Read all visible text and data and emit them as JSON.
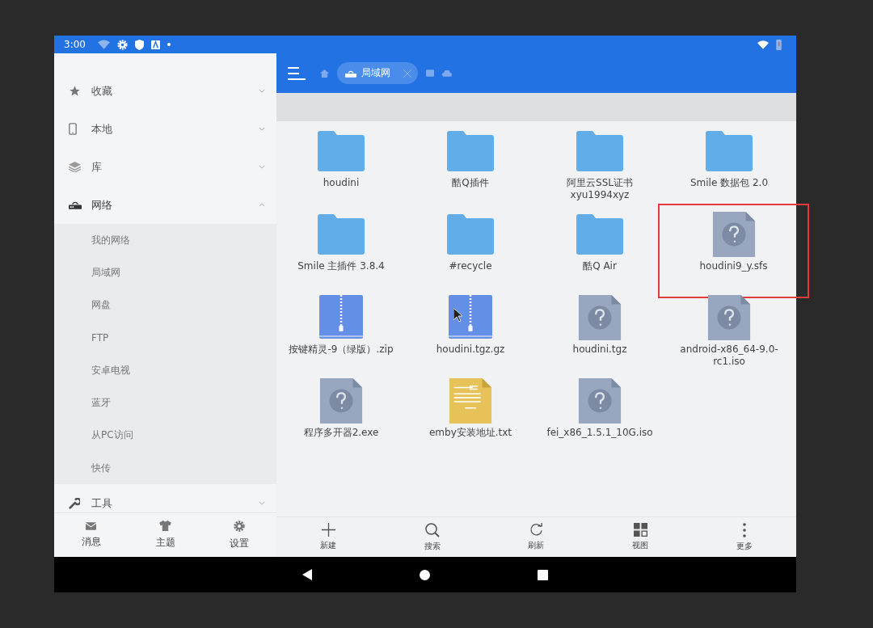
{
  "status_bar": {
    "time": "3:00"
  },
  "sidebar": {
    "items": [
      {
        "kind": "star",
        "label": "收藏",
        "expanded": false
      },
      {
        "kind": "phone",
        "label": "本地",
        "expanded": false
      },
      {
        "kind": "layers",
        "label": "库",
        "expanded": false
      },
      {
        "kind": "router",
        "label": "网络",
        "expanded": true,
        "children": [
          {
            "label": "我的网络"
          },
          {
            "label": "局域网"
          },
          {
            "label": "网盘"
          },
          {
            "label": "FTP"
          },
          {
            "label": "安卓电视"
          },
          {
            "label": "蓝牙"
          },
          {
            "label": "从PC访问"
          },
          {
            "label": "快传"
          }
        ]
      },
      {
        "kind": "wrench",
        "label": "工具",
        "expanded": false
      }
    ],
    "tabs": [
      {
        "kind": "mail",
        "label": "消息"
      },
      {
        "kind": "shirt",
        "label": "主题"
      },
      {
        "kind": "gear",
        "label": "设置"
      }
    ]
  },
  "breadcrumb": {
    "chip": "局域网"
  },
  "files": [
    {
      "kind": "folder",
      "name": "houdini",
      "highlighted": false
    },
    {
      "kind": "folder",
      "name": "酷Q插件",
      "highlighted": false
    },
    {
      "kind": "folder",
      "name": "阿里云SSL证书xyu1994xyz",
      "highlighted": false
    },
    {
      "kind": "folder",
      "name": "Smile 数据包 2.0",
      "highlighted": false
    },
    {
      "kind": "folder",
      "name": "Smile 主插件 3.8.4",
      "highlighted": false
    },
    {
      "kind": "folder",
      "name": "#recycle",
      "highlighted": false
    },
    {
      "kind": "folder",
      "name": "酷Q Air",
      "highlighted": false
    },
    {
      "kind": "unknown",
      "name": "houdini9_y.sfs",
      "highlighted": true
    },
    {
      "kind": "zip",
      "name": "按键精灵-9（绿版）.zip",
      "highlighted": false
    },
    {
      "kind": "zip",
      "name": "houdini.tgz.gz",
      "highlighted": false
    },
    {
      "kind": "unknown",
      "name": "houdini.tgz",
      "highlighted": false
    },
    {
      "kind": "unknown",
      "name": "android-x86_64-9.0-rc1.iso",
      "highlighted": false
    },
    {
      "kind": "unknown",
      "name": "程序多开器2.exe",
      "highlighted": false
    },
    {
      "kind": "text",
      "name": "emby安装地址.txt",
      "highlighted": false
    },
    {
      "kind": "unknown",
      "name": "fei_x86_1.5.1_10G.iso",
      "highlighted": false
    }
  ],
  "toolbar": [
    {
      "kind": "plus",
      "label": "新建"
    },
    {
      "kind": "search",
      "label": "搜索"
    },
    {
      "kind": "refresh",
      "label": "刷新"
    },
    {
      "kind": "grid",
      "label": "视图"
    },
    {
      "kind": "more",
      "label": "更多"
    }
  ]
}
